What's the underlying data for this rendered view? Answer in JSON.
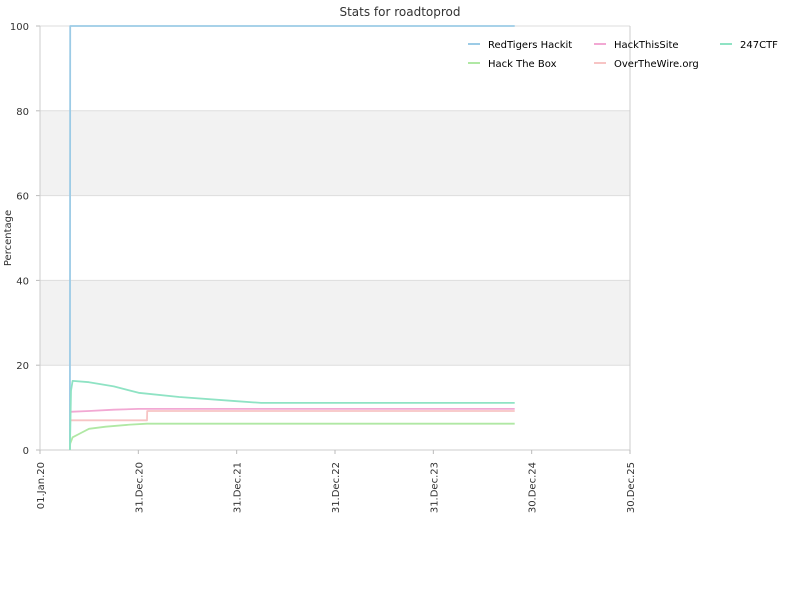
{
  "chart_data": {
    "type": "line",
    "title": "Stats for roadtoprod",
    "xlabel": "",
    "ylabel": "Percentage",
    "ylim": [
      0,
      100
    ],
    "y_ticks": [
      0,
      20,
      40,
      60,
      80,
      100
    ],
    "x_ticks": [
      "01.Jan.20",
      "31.Dec.20",
      "31.Dec.21",
      "31.Dec.22",
      "31.Dec.23",
      "30.Dec.24",
      "30.Dec.25"
    ],
    "xlim": [
      "2020-01-01",
      "2025-12-30"
    ],
    "grid": true,
    "banded_background": true,
    "legend_position": "top-right",
    "series": [
      {
        "name": "RedTigers Hackit",
        "color": "#9ccbe6",
        "points": [
          [
            "2020-04-21",
            0
          ],
          [
            "2020-04-22",
            100
          ],
          [
            "2024-10-28",
            100
          ]
        ]
      },
      {
        "name": "Hack The Box",
        "color": "#b0e8a4",
        "points": [
          [
            "2020-04-21",
            0
          ],
          [
            "2020-04-22",
            1.5
          ],
          [
            "2020-05-01",
            3
          ],
          [
            "2020-06-01",
            4
          ],
          [
            "2020-07-01",
            5
          ],
          [
            "2020-09-01",
            5.5
          ],
          [
            "2020-12-01",
            6
          ],
          [
            "2021-02-01",
            6.2
          ],
          [
            "2024-10-28",
            6.2
          ]
        ]
      },
      {
        "name": "HackThisSite",
        "color": "#f2a8d3",
        "points": [
          [
            "2020-04-21",
            9
          ],
          [
            "2020-07-01",
            9.2
          ],
          [
            "2020-10-01",
            9.5
          ],
          [
            "2021-01-01",
            9.7
          ],
          [
            "2024-10-28",
            9.7
          ]
        ]
      },
      {
        "name": "OverTheWire.org",
        "color": "#f7c4c4",
        "points": [
          [
            "2020-04-21",
            7
          ],
          [
            "2021-02-01",
            7
          ],
          [
            "2021-02-02",
            9.2
          ],
          [
            "2024-10-28",
            9.2
          ]
        ]
      },
      {
        "name": "247CTF",
        "color": "#8fe3c4",
        "points": [
          [
            "2020-04-21",
            0
          ],
          [
            "2020-04-25",
            14
          ],
          [
            "2020-05-01",
            16.3
          ],
          [
            "2020-07-01",
            16
          ],
          [
            "2020-10-01",
            15
          ],
          [
            "2021-01-01",
            13.5
          ],
          [
            "2021-06-01",
            12.5
          ],
          [
            "2021-12-31",
            11.5
          ],
          [
            "2022-04-01",
            11.1
          ],
          [
            "2024-10-28",
            11.1
          ]
        ]
      }
    ]
  }
}
